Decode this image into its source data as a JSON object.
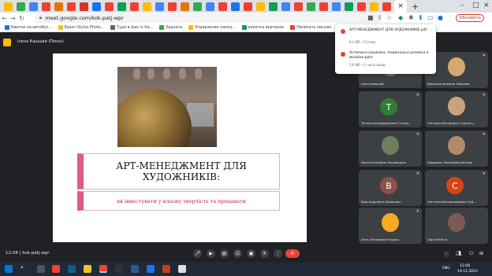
{
  "browser": {
    "new_tab": "+",
    "url": "meet.google.com/kok-patj-wpr",
    "update_label": "Обновить",
    "bookmarks": [
      {
        "label": "Квитки на автобус..."
      },
      {
        "label": "Epson Stylus Photo..."
      },
      {
        "label": "Тури в Ірак із Ки..."
      },
      {
        "label": "Удалить"
      },
      {
        "label": "Управление папка..."
      },
      {
        "label": "анкетка вертанок"
      },
      {
        "label": "Написать письмо"
      }
    ]
  },
  "meet": {
    "presenter_label": "Ілона Кашшай (Показ)",
    "time_code": "12:08 | kok-patj-wpr"
  },
  "slide": {
    "title": "АРТ-МЕНЕДЖМЕНТ ДЛЯ ХУДОЖНИКІВ:",
    "subtitle": "як інвестувати у власну творчість та продавати"
  },
  "downloads": [
    {
      "name": "АРТ-МЕНЕДЖМЕНТ ДЛЯ ХУДОЖНИКІВ.pdf",
      "status": "6,3 МБ • Готово"
    },
    {
      "name": "Античина кераміка. поминальні розписи в мозаїки.pptx",
      "status": "5,6 МБ • 2 часа назад"
    }
  ],
  "participants": [
    {
      "name": "Ілона Кашшай",
      "initial": "",
      "color": "#8d6e63"
    },
    {
      "name": "Вероніка Іванівна Зайцева",
      "initial": "",
      "color": "#d7a86e"
    },
    {
      "name": "Тетяна Володимирівна Гнезді...",
      "initial": "Т",
      "color": "#2e7d32"
    },
    {
      "name": "Світлана Вікторівна Стрельц...",
      "initial": "",
      "color": "#c9a27e"
    },
    {
      "name": "Євгенія Юріївна Лисовецька",
      "initial": "",
      "color": "#6d7f5c"
    },
    {
      "name": "Людмила Леонідівна Вечера",
      "initial": "",
      "color": "#b08a6a"
    },
    {
      "name": "Віра Андріївна Шпакович",
      "initial": "В",
      "color": "#8e4f4a"
    },
    {
      "name": "Світлана Володимирівна Чуй...",
      "initial": "С",
      "color": "#d84315"
    },
    {
      "name": "Анна Леонідівна Карась",
      "initial": "",
      "color": "#f9a825"
    },
    {
      "name": "Olga Shkolna",
      "initial": "",
      "color": "#7a5a55"
    }
  ],
  "taskbar": {
    "lang": "ENG",
    "time": "12:08",
    "date": "19.12.2023"
  },
  "icons": {
    "tab": "chrome-tab-icons",
    "address": "lock-icon"
  }
}
